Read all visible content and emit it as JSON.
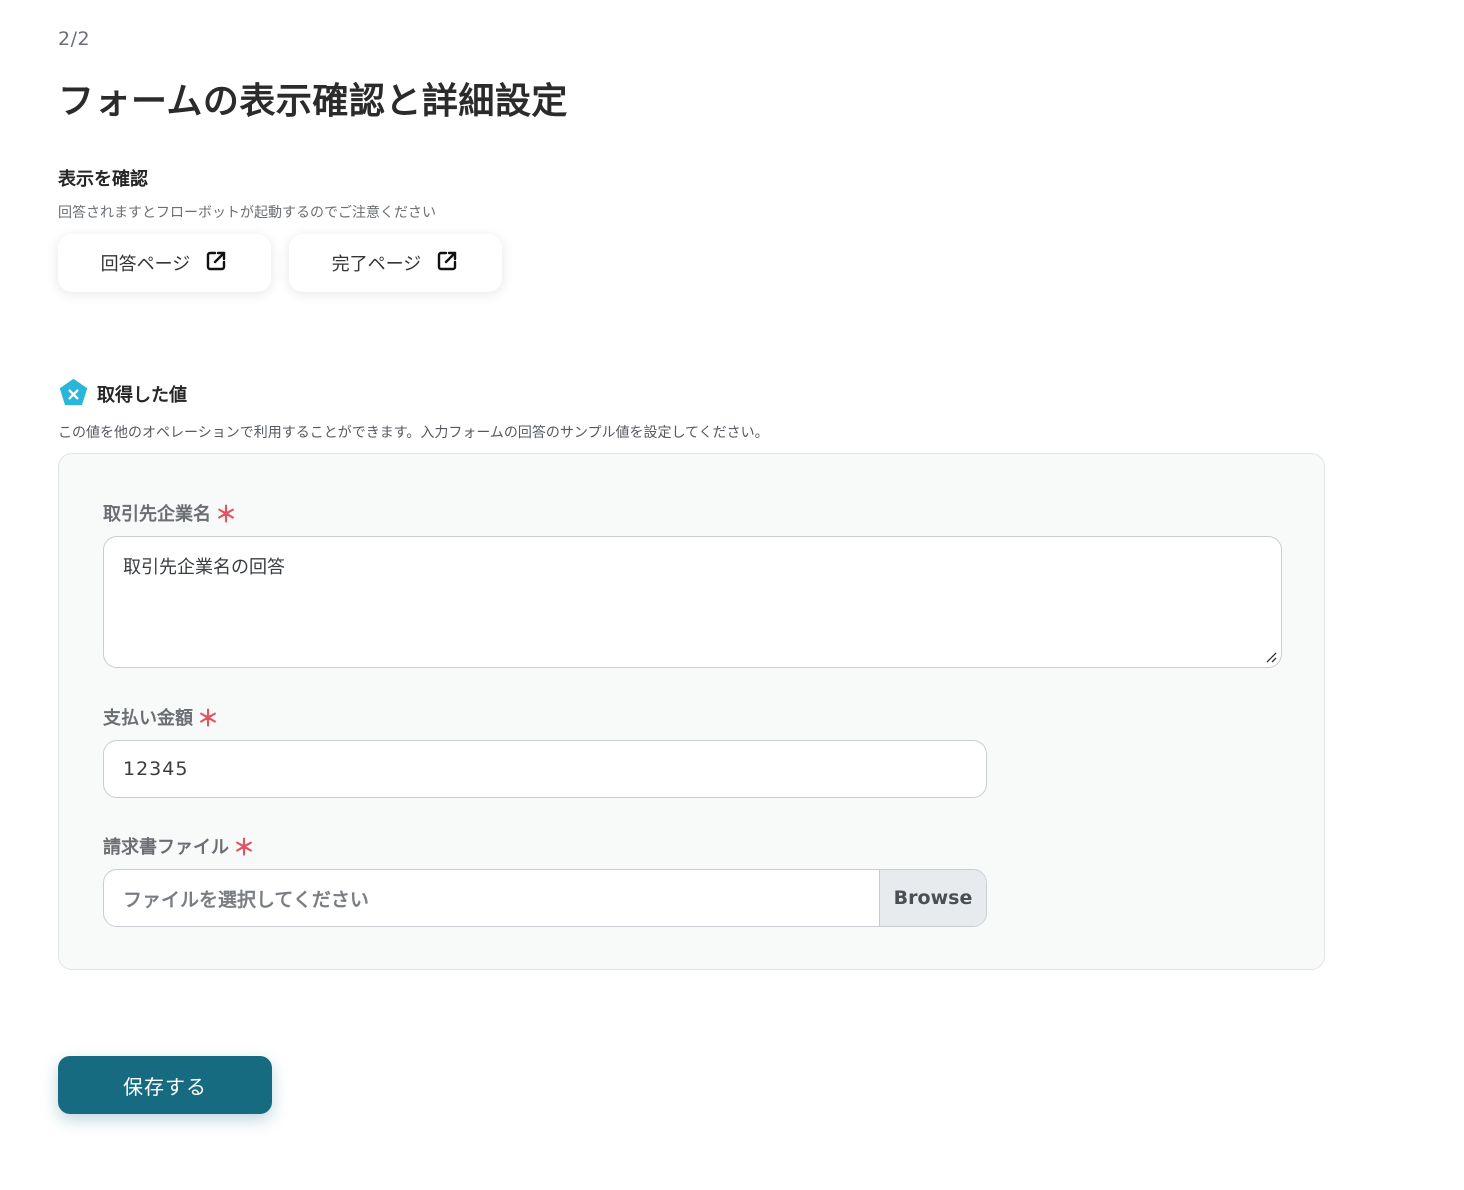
{
  "header": {
    "step": "2/2",
    "title": "フォームの表示確認と詳細設定"
  },
  "preview": {
    "title": "表示を確認",
    "description": "回答されますとフローボットが起動するのでご注意ください",
    "buttons": [
      {
        "label": "回答ページ",
        "icon": "external-link-icon"
      },
      {
        "label": "完了ページ",
        "icon": "external-link-icon"
      }
    ]
  },
  "acquired": {
    "icon": "yoom-logo-icon",
    "title": "取得した値",
    "description": "この値を他のオペレーションで利用することができます。入力フォームの回答のサンプル値を設定してください。"
  },
  "fields": {
    "company": {
      "label": "取引先企業名",
      "required_mark": "＊",
      "value": "取引先企業名の回答"
    },
    "amount": {
      "label": "支払い金額",
      "required_mark": "＊",
      "value": "12345"
    },
    "invoice": {
      "label": "請求書ファイル",
      "required_mark": "＊",
      "placeholder": "ファイルを選択してください",
      "browse_label": "Browse"
    }
  },
  "actions": {
    "save_label": "保存する"
  },
  "colors": {
    "primary": "#176b80",
    "required": "#e05563",
    "icon_accent": "#29b6d9"
  }
}
